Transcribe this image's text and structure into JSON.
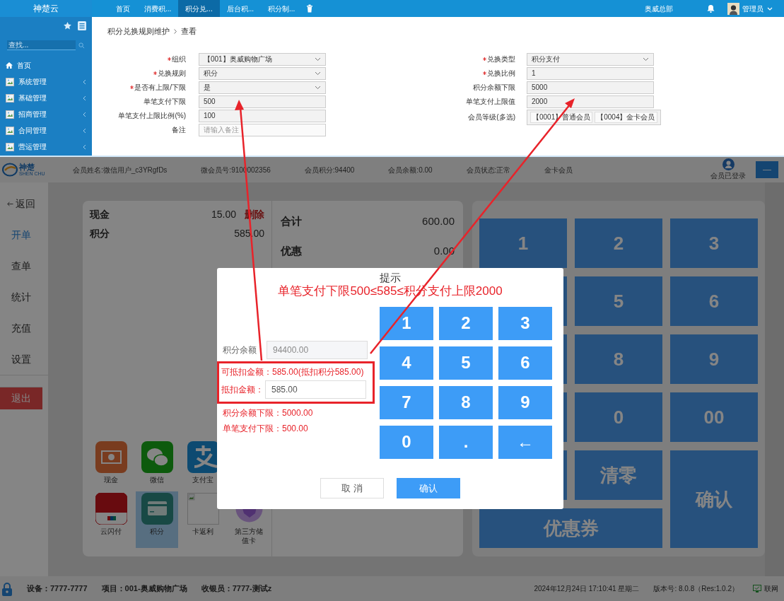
{
  "admin": {
    "brand": "神楚云",
    "tabs": [
      {
        "label": "首页",
        "selected": false
      },
      {
        "label": "消费积...",
        "selected": false
      },
      {
        "label": "积分兑...",
        "selected": true
      },
      {
        "label": "后台积...",
        "selected": false
      },
      {
        "label": "积分制...",
        "selected": false
      }
    ],
    "org": "奥威总部",
    "user": "管理员",
    "sidebar": {
      "search_placeholder": "查找...",
      "items": [
        {
          "label": "首页",
          "kind": "home"
        },
        {
          "label": "系统管理",
          "kind": "group"
        },
        {
          "label": "基础管理",
          "kind": "group"
        },
        {
          "label": "招商管理",
          "kind": "group"
        },
        {
          "label": "合同管理",
          "kind": "group"
        },
        {
          "label": "营运管理",
          "kind": "group"
        }
      ]
    },
    "breadcrumb": [
      "积分兑换规则维护",
      "查看"
    ],
    "form_left": [
      {
        "label": "组织",
        "required": true,
        "kind": "select",
        "value": "【001】奥威购物广场"
      },
      {
        "label": "兑换规则",
        "required": true,
        "kind": "select",
        "value": "积分"
      },
      {
        "label": "是否有上限/下限",
        "required": true,
        "kind": "select",
        "value": "是"
      },
      {
        "label": "单笔支付下限",
        "required": false,
        "kind": "input",
        "value": "500"
      },
      {
        "label": "单笔支付上限比例(%)",
        "required": false,
        "kind": "input",
        "value": "100"
      },
      {
        "label": "备注",
        "required": false,
        "kind": "input",
        "placeholder": "请输入备注"
      }
    ],
    "form_right": [
      {
        "label": "兑换类型",
        "required": true,
        "kind": "select",
        "value": "积分支付"
      },
      {
        "label": "兑换比例",
        "required": true,
        "kind": "input",
        "value": "1"
      },
      {
        "label": "积分余额下限",
        "required": false,
        "kind": "input",
        "value": "5000"
      },
      {
        "label": "单笔支付上限值",
        "required": false,
        "kind": "input",
        "value": "2000"
      },
      {
        "label": "会员等级(多选)",
        "required": false,
        "kind": "tags",
        "tags": [
          "【0001】普通会员",
          "【0004】金卡会员"
        ]
      }
    ]
  },
  "pos": {
    "logo": {
      "name": "神楚",
      "sub": "SHEN CHU"
    },
    "member_fields": [
      "会员姓名:微信用户_c3YRgfDs",
      "微会员号:9100002356",
      "会员积分:94400",
      "会员余额:0.00",
      "会员状态:正常",
      "金卡会员"
    ],
    "login_status": "会员已登录",
    "header_button": "—",
    "nav": [
      {
        "label": "返回",
        "kind": "back",
        "selected": false
      },
      {
        "label": "开单",
        "kind": "item",
        "selected": true
      },
      {
        "label": "查单",
        "kind": "item",
        "selected": false
      },
      {
        "label": "统计",
        "kind": "item",
        "selected": false
      },
      {
        "label": "充值",
        "kind": "item",
        "selected": false
      },
      {
        "label": "设置",
        "kind": "item",
        "selected": false
      },
      {
        "label": "退出",
        "kind": "exit"
      }
    ],
    "payments": [
      {
        "name": "现金",
        "amount": "15.00",
        "action": "删除"
      },
      {
        "name": "积分",
        "amount": "585.00"
      }
    ],
    "totals": [
      {
        "label": "合计",
        "value": "600.00"
      },
      {
        "label": "优惠",
        "value": "0.00"
      }
    ],
    "pay_methods": [
      {
        "label": "现金",
        "kind": "cash",
        "selected": false
      },
      {
        "label": "微信",
        "kind": "wechat",
        "selected": false
      },
      {
        "label": "支付宝",
        "kind": "alipay",
        "selected": false
      },
      {
        "kind": "covered"
      },
      {
        "label": "云闪付",
        "kind": "unionpay",
        "selected": false
      },
      {
        "label": "积分",
        "kind": "points",
        "selected": true
      },
      {
        "label": "卡返利",
        "kind": "broken",
        "selected": false
      },
      {
        "label": "第三方储值卡",
        "kind": "vip",
        "selected": false
      }
    ],
    "keypad": [
      {
        "label": "1",
        "kind": "key"
      },
      {
        "label": "2",
        "kind": "key"
      },
      {
        "label": "3",
        "kind": "key"
      },
      {
        "kind": "covered"
      },
      {
        "label": "5",
        "kind": "key"
      },
      {
        "label": "6",
        "kind": "key"
      },
      {
        "kind": "covered"
      },
      {
        "label": "8",
        "kind": "key"
      },
      {
        "label": "9",
        "kind": "key"
      },
      {
        "kind": "covered"
      },
      {
        "label": "0",
        "kind": "key"
      },
      {
        "label": "00",
        "kind": "key"
      },
      {
        "kind": "covered"
      },
      {
        "label": "清零",
        "kind": "key"
      },
      {
        "label": "确认",
        "kind": "tall"
      },
      {
        "label": "优惠券",
        "kind": "wide"
      }
    ],
    "status_bar": {
      "device": "设备：7777-7777",
      "project": "项目：001-奥威购物广场",
      "cashier": "收银员：7777-测试z",
      "datetime": "2024年12月24日 17:10:41 星期二",
      "version": "版本号: 8.0.8（Res:1.0.2）",
      "network": "联网"
    }
  },
  "dialog": {
    "title": "提示",
    "message": "单笔支付下限500≤585≤积分支付上限2000",
    "balance": {
      "label": "积分余额：",
      "value": "94400.00",
      "disabled": true
    },
    "available": "可抵扣金额：585.00(抵扣积分585.00)",
    "deduct": {
      "label": "抵扣金额：",
      "value": "585.00",
      "disabled": false
    },
    "notes": [
      "积分余额下限：5000.00",
      "单笔支付下限：500.00"
    ],
    "keys": [
      "1",
      "2",
      "3",
      "4",
      "5",
      "6",
      "7",
      "8",
      "9",
      "0",
      ".",
      "←"
    ],
    "buttons": [
      {
        "label": "取 消",
        "kind": "cancel"
      },
      {
        "label": "确认",
        "kind": "confirm"
      }
    ]
  }
}
